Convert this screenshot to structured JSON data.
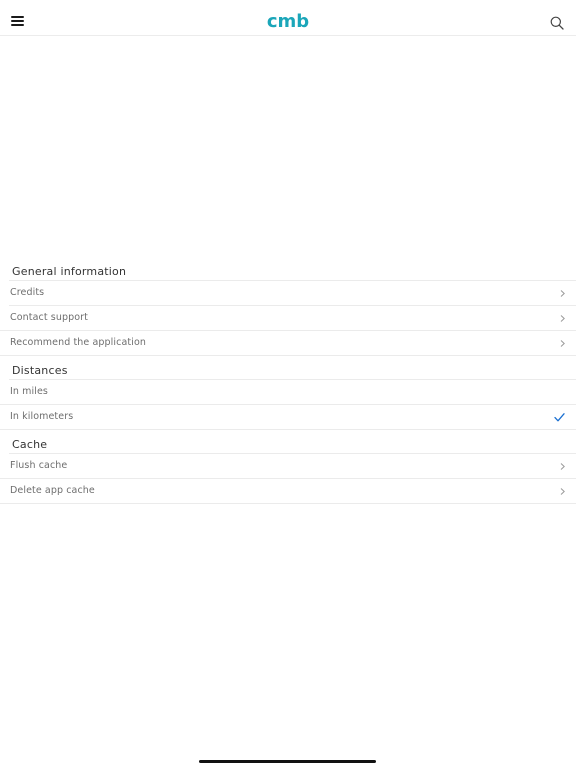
{
  "header": {
    "logo_text": "cmb",
    "logo_color": "#1ba6b9",
    "menu_icon": "hamburger-menu-icon",
    "search_icon": "search-icon"
  },
  "sections": [
    {
      "title": "General information",
      "items": [
        {
          "label": "Credits",
          "accessory": "chevron-right-icon"
        },
        {
          "label": "Contact support",
          "accessory": "chevron-right-icon"
        },
        {
          "label": "Recommend the application",
          "accessory": "chevron-right-icon"
        }
      ]
    },
    {
      "title": "Distances",
      "items": [
        {
          "label": "In miles",
          "accessory": "none",
          "selected": false
        },
        {
          "label": "In kilometers",
          "accessory": "checkmark-icon",
          "selected": true
        }
      ]
    },
    {
      "title": "Cache",
      "items": [
        {
          "label": "Flush cache",
          "accessory": "chevron-right-icon"
        },
        {
          "label": "Delete app cache",
          "accessory": "chevron-right-icon"
        }
      ]
    }
  ],
  "colors": {
    "accent": "#1a6fd1",
    "label": "#6e6e6e",
    "section_title": "#333333",
    "divider": "#ebebeb"
  }
}
